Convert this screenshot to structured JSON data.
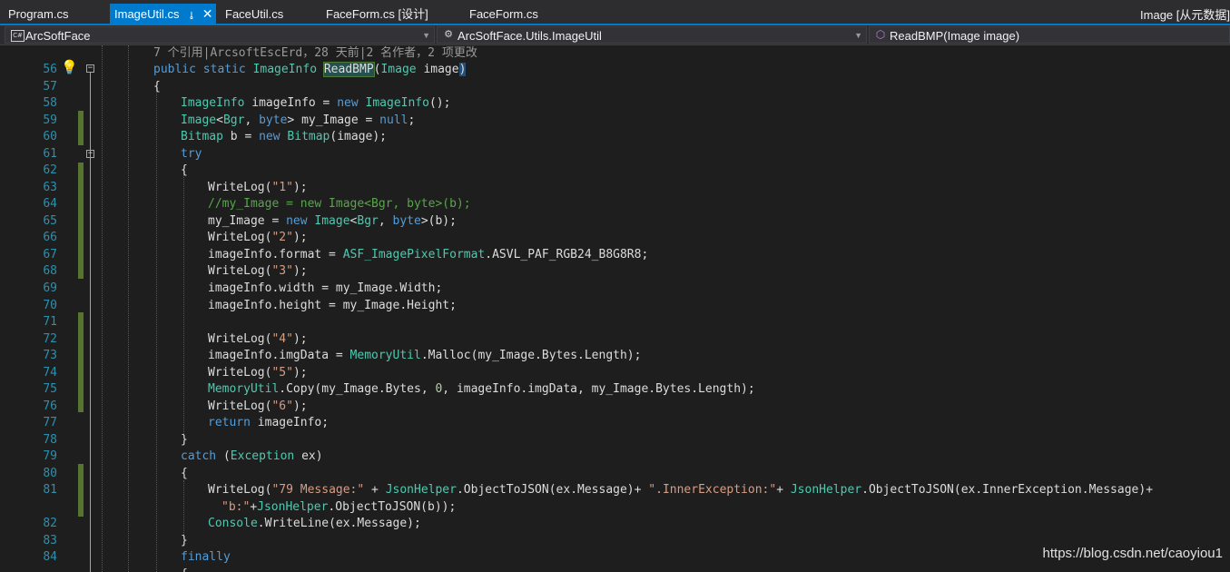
{
  "tabs": [
    {
      "label": "Program.cs",
      "active": false
    },
    {
      "label": "ImageUtil.cs",
      "active": true
    },
    {
      "label": "FaceUtil.cs",
      "active": false
    },
    {
      "label": "FaceForm.cs [设计]",
      "active": false
    },
    {
      "label": "FaceForm.cs",
      "active": false
    }
  ],
  "tab_right": "Image [从元数据]",
  "nav": {
    "project": "ArcSoftFace",
    "class": "ArcSoftFace.Utils.ImageUtil",
    "member": "ReadBMP(Image image)"
  },
  "codelens": "7 个引用|ArcsoftEscErd，28 天前|2 名作者，2 项更改",
  "line_numbers": [
    "56",
    "57",
    "58",
    "59",
    "60",
    "61",
    "62",
    "63",
    "64",
    "65",
    "66",
    "67",
    "68",
    "69",
    "70",
    "71",
    "72",
    "73",
    "74",
    "75",
    "76",
    "77",
    "78",
    "79",
    "80",
    "81",
    "",
    "82",
    "83",
    "84"
  ],
  "watermark": "https://blog.csdn.net/caoyiou1",
  "colors": {
    "background": "#1e1e1e",
    "keyword": "#569cd6",
    "type": "#4ec9b0",
    "string": "#d69d85",
    "comment": "#57a64a",
    "line_number": "#2b91af",
    "accent": "#007acc",
    "change_bar": "#577430"
  }
}
